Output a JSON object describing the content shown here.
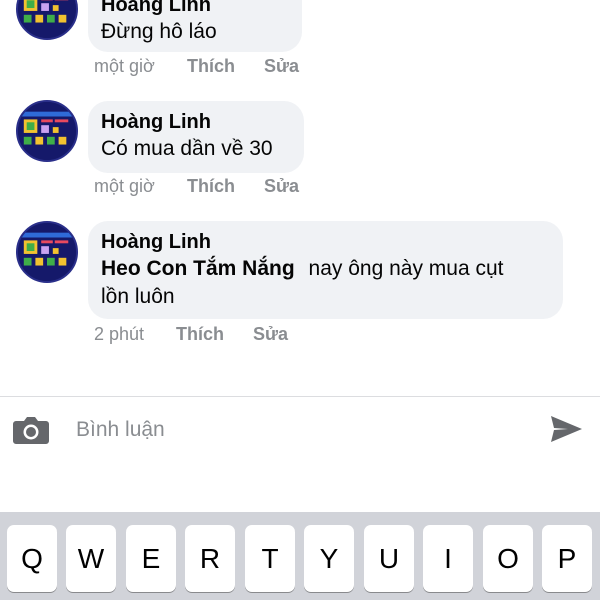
{
  "comments": [
    {
      "author": "Hoàng Linh",
      "text": "Đừng hô láo",
      "time": "một giờ",
      "like": "Thích",
      "edit": "Sửa"
    },
    {
      "author": "Hoàng Linh",
      "text": "Có mua dần về 30",
      "time": "một giờ",
      "like": "Thích",
      "edit": "Sửa"
    },
    {
      "author": "Hoàng Linh",
      "mention": "Heo Con Tắm Nắng",
      "text_line1": "nay ông này mua cụt",
      "text_line2": "lồn luôn",
      "time": "2 phút",
      "like": "Thích",
      "edit": "Sửa"
    }
  ],
  "composer": {
    "placeholder": "Bình luận",
    "camera_icon": "camera-icon",
    "send_icon": "send-icon"
  },
  "keyboard": {
    "keys": [
      "Q",
      "W",
      "E",
      "R",
      "T",
      "Y",
      "U",
      "I",
      "O",
      "P"
    ]
  },
  "colors": {
    "bubble": "#f0f2f5",
    "meta_text": "#8a8d91",
    "keyboard_bg": "#d1d3d9"
  }
}
